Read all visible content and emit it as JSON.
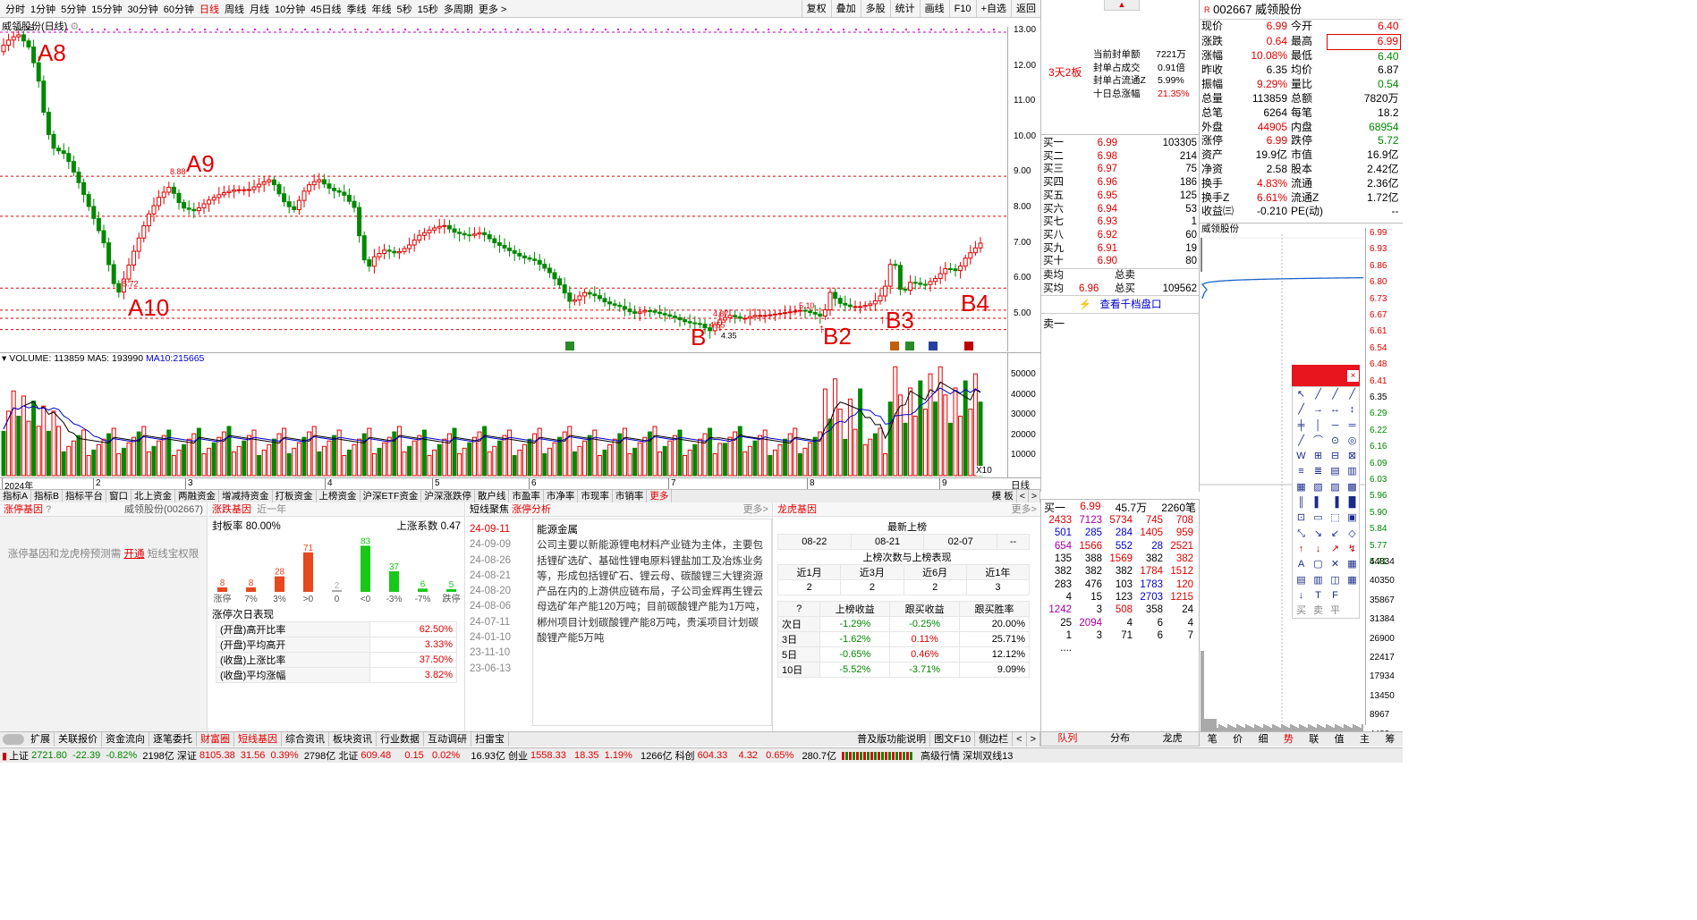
{
  "periods": [
    "分时",
    "1分钟",
    "5分钟",
    "15分钟",
    "30分钟",
    "60分钟",
    "日线",
    "周线",
    "月线",
    "10分钟",
    "45日线",
    "季线",
    "年线",
    "5秒",
    "15秒",
    "多周期",
    "更多 >"
  ],
  "active_period": "日线",
  "tools": [
    "复权",
    "叠加",
    "多股",
    "统计",
    "画线",
    "F10",
    "+自选",
    "返回"
  ],
  "chart_title": "威领股份(日线)",
  "price_axis": [
    "13.00",
    "12.00",
    "11.00",
    "10.00",
    "9.00",
    "8.00",
    "7.00",
    "6.00",
    "5.00"
  ],
  "price_labels": {
    "high": "12.95",
    "p888": "8.88",
    "p572": "5.72",
    "p510": "5.10",
    "p487": "4.87",
    "p455": "4.55",
    "p435": "4.35"
  },
  "annotations": [
    "A8",
    "A9",
    "A10",
    "B",
    "B2",
    "B3",
    "B4"
  ],
  "volume_header": {
    "label": "VOLUME:",
    "vol": "113859",
    "ma5_label": "MA5:",
    "ma5": "193990",
    "ma10_label": "MA10:",
    "ma10": "215665"
  },
  "volume_axis": [
    "50000",
    "40000",
    "30000",
    "20000",
    "10000"
  ],
  "volume_unit": "X10",
  "date_axis": {
    "year": "2024年",
    "m2": "2",
    "m3": "3",
    "m4": "4",
    "m5": "5",
    "m6": "6",
    "m7": "7",
    "m8": "8",
    "m9": "9",
    "right": "日线"
  },
  "bottom_tabs": [
    "指标A",
    "指标B",
    "指标平台",
    "窗口",
    "北上资金",
    "两融资金",
    "增减持资金",
    "打板资金",
    "上榜资金",
    "沪深ETF资金",
    "沪深涨跌停",
    "散户线",
    "市盈率",
    "市净率",
    "市现率",
    "市销率",
    "更多"
  ],
  "bottom_right": [
    "模 板",
    "<",
    ">"
  ],
  "panel1": {
    "title": "涨停基因",
    "hint": "?",
    "code_name": "威领股份(002667)",
    "promo_a": "涨停基因和龙虎榜预测需",
    "promo_link": "开通",
    "promo_b": "短线宝权限"
  },
  "panel2": {
    "title": "涨跌基因",
    "period": "近一年",
    "seal_label": "封板率",
    "seal_value": "80.00%",
    "up_label": "上涨系数",
    "up_value": "0.47",
    "bars": [
      {
        "label": "涨停",
        "value": "8"
      },
      {
        "label": "7%",
        "value": "8"
      },
      {
        "label": "3%",
        "value": "28"
      },
      {
        "label": ">0",
        "value": "71"
      },
      {
        "label": "0",
        "value": "2"
      },
      {
        "label": "<0",
        "value": "83"
      },
      {
        "label": "-3%",
        "value": "37"
      },
      {
        "label": "-7%",
        "value": "6"
      },
      {
        "label": "跌停",
        "value": "5"
      }
    ],
    "next_title": "涨停次日表现",
    "next_rows": [
      {
        "k": "(开盘)高开比率",
        "v": "62.50%"
      },
      {
        "k": "(开盘)平均高开",
        "v": "3.33%"
      },
      {
        "k": "(收盘)上涨比率",
        "v": "37.50%"
      },
      {
        "k": "(收盘)平均涨幅",
        "v": "3.82%"
      }
    ]
  },
  "panel3": {
    "title": "短线聚焦",
    "tab": "涨停分析",
    "more": "更多>",
    "dates": [
      "24-09-11",
      "24-09-09",
      "24-08-26",
      "24-08-21",
      "24-08-20",
      "24-08-06",
      "24-07-11",
      "24-01-10",
      "23-11-10",
      "23-06-13"
    ],
    "topic": "能源金属",
    "desc": "公司主要以新能源锂电材料产业链为主体，主要包括锂矿选矿、基础性锂电原料锂盐加工及冶炼业务等，形成包括锂矿石、锂云母、碳酸锂三大锂资源产品在内的上游供应链布局，子公司金辉再生锂云母选矿年产能120万吨；目前碳酸锂产能为1万吨，郴州项目计划碳酸锂产能8万吨，贵溪项目计划碳酸锂产能5万吨"
  },
  "panel4": {
    "title": "龙虎基因",
    "more": "更多>",
    "latest_title": "最新上榜",
    "latest_dates": [
      "08-22",
      "08-21",
      "02-07",
      "--"
    ],
    "count_title": "上榜次数与上榜表现",
    "count_headers": [
      "近1月",
      "近3月",
      "近6月",
      "近1年"
    ],
    "counts": [
      "2",
      "2",
      "2",
      "3"
    ],
    "perf_headers": [
      "?",
      "上榜收益",
      "跟买收益",
      "跟买胜率"
    ],
    "perf_rows": [
      [
        "次日",
        "-1.29%",
        "-0.25%",
        "20.00%"
      ],
      [
        "3日",
        "-1.62%",
        "0.11%",
        "25.71%"
      ],
      [
        "5日",
        "-0.65%",
        "0.46%",
        "12.12%"
      ],
      [
        "10日",
        "-5.52%",
        "-3.71%",
        "9.09%"
      ]
    ]
  },
  "footer_tabs": [
    "扩展",
    "关联报价",
    "资金流向",
    "逐笔委托",
    "财富圈",
    "短线基因",
    "综合资讯",
    "板块资讯",
    "行业数据",
    "互动调研",
    "扫雷宝"
  ],
  "footer_right": [
    "普及版功能说明",
    "图文F10",
    "侧边栏",
    "<",
    ">"
  ],
  "limit_info": {
    "board": "3天2板",
    "rows": [
      {
        "k": "封单额",
        "v": "7221万",
        "prefix": "当前"
      },
      {
        "k": "封单占成交",
        "v": "0.91倍"
      },
      {
        "k": "封单占流通Z",
        "v": "5.99%"
      },
      {
        "k": "十日总涨幅",
        "v": "21.35%"
      }
    ]
  },
  "stock": {
    "code": "002667",
    "name": "威领股份"
  },
  "quote": [
    [
      "现价",
      "6.99",
      "今开",
      "6.40"
    ],
    [
      "涨跌",
      "0.64",
      "最高",
      "6.99"
    ],
    [
      "涨幅",
      "10.08%",
      "最低",
      "6.40"
    ],
    [
      "昨收",
      "6.35",
      "均价",
      "6.87"
    ],
    [
      "振幅",
      "9.29%",
      "量比",
      "0.54"
    ],
    [
      "总量",
      "113859",
      "总额",
      "7820万"
    ],
    [
      "总笔",
      "6264",
      "每笔",
      "18.2"
    ],
    [
      "外盘",
      "44905",
      "内盘",
      "68954"
    ],
    [
      "涨停",
      "6.99",
      "跌停",
      "5.72"
    ],
    [
      "资产",
      "19.9亿",
      "市值",
      "16.9亿"
    ],
    [
      "净资",
      "2.58",
      "股本",
      "2.42亿"
    ],
    [
      "换手",
      "4.83%",
      "流通",
      "2.36亿"
    ],
    [
      "换手Z",
      "6.61%",
      "流通Z",
      "1.72亿"
    ],
    [
      "收益㈢",
      "-0.210",
      "PE(动)",
      "--"
    ]
  ],
  "bids": [
    [
      "买一",
      "6.99",
      "103305"
    ],
    [
      "买二",
      "6.98",
      "214"
    ],
    [
      "买三",
      "6.97",
      "75"
    ],
    [
      "买四",
      "6.96",
      "186"
    ],
    [
      "买五",
      "6.95",
      "125"
    ],
    [
      "买六",
      "6.94",
      "53"
    ],
    [
      "买七",
      "6.93",
      "1"
    ],
    [
      "买八",
      "6.92",
      "60"
    ],
    [
      "买九",
      "6.91",
      "19"
    ],
    [
      "买十",
      "6.90",
      "80"
    ]
  ],
  "avg": [
    [
      "卖均",
      "",
      "总卖",
      ""
    ],
    [
      "买均",
      "6.96",
      "总买",
      "109562"
    ]
  ],
  "qiandang": "查看千档盘口",
  "sell1": "卖一",
  "buy1_row": {
    "label": "买一",
    "price": "6.99",
    "amount": "45.7万",
    "unit": "笔",
    "count": "2260笔"
  },
  "queue": [
    [
      "2433",
      "7123",
      "5734",
      "745",
      "708"
    ],
    [
      "501",
      "285",
      "284",
      "1405",
      "959"
    ],
    [
      "654",
      "1566",
      "552",
      "28",
      "2521"
    ],
    [
      "135",
      "388",
      "1569",
      "382",
      "382"
    ],
    [
      "382",
      "382",
      "382",
      "1784",
      "1512"
    ],
    [
      "283",
      "476",
      "103",
      "1783",
      "120"
    ],
    [
      "4",
      "15",
      "123",
      "2703",
      "1215"
    ],
    [
      "1242",
      "3",
      "508",
      "358",
      "24"
    ],
    [
      "25",
      "2094",
      "4",
      "6",
      "4"
    ],
    [
      "1",
      "3",
      "71",
      "6",
      "7"
    ],
    [
      "....",
      "",
      "",
      "",
      ""
    ]
  ],
  "mini_title": "威领股份",
  "mini_price_axis": [
    "6.99",
    "6.93",
    "6.86",
    "6.80",
    "6.73",
    "6.67",
    "6.61",
    "6.54",
    "6.48",
    "6.41",
    "6.35",
    "6.29",
    "6.22",
    "6.16",
    "6.09",
    "6.03",
    "5.96",
    "5.90",
    "5.84",
    "5.77",
    "5.71"
  ],
  "mini_vol_axis": [
    "44834",
    "40350",
    "35867",
    "31384",
    "26900",
    "22417",
    "17934",
    "13450",
    "8967",
    "4483"
  ],
  "right_tabs": [
    "队列",
    "分布",
    "龙虎"
  ],
  "far_tabs": [
    "笔",
    "价",
    "细",
    "势",
    "联",
    "值",
    "主",
    "筹"
  ],
  "trade_btns": [
    "买",
    "卖",
    "平"
  ],
  "status": {
    "sh_label": "上证",
    "sh": "2721.80",
    "sh_chg": "-22.39",
    "sh_pct": "-0.82%",
    "sh_amt": "2198亿",
    "sz_label": "深证",
    "sz": "8105.38",
    "sz_chg": "31.56",
    "sz_pct": "0.39%",
    "sz_amt": "2798亿",
    "bb_label": "北证",
    "bb": "609.48",
    "bb_chg": "0.15",
    "bb_pct": "0.02%",
    "bb_amt": "16.93亿",
    "cy_label": "创业",
    "cy": "1558.33",
    "cy_chg": "18.35",
    "cy_pct": "1.19%",
    "cy_amt": "1266亿",
    "kc_label": "科创",
    "kc": "604.33",
    "kc_chg": "4.32",
    "kc_pct": "0.65%",
    "kc_amt": "280.7亿",
    "right": "高级行情 深圳双线13"
  },
  "colors": {
    "up": "#e00000",
    "down": "#008800",
    "ma": "#0000cc"
  }
}
